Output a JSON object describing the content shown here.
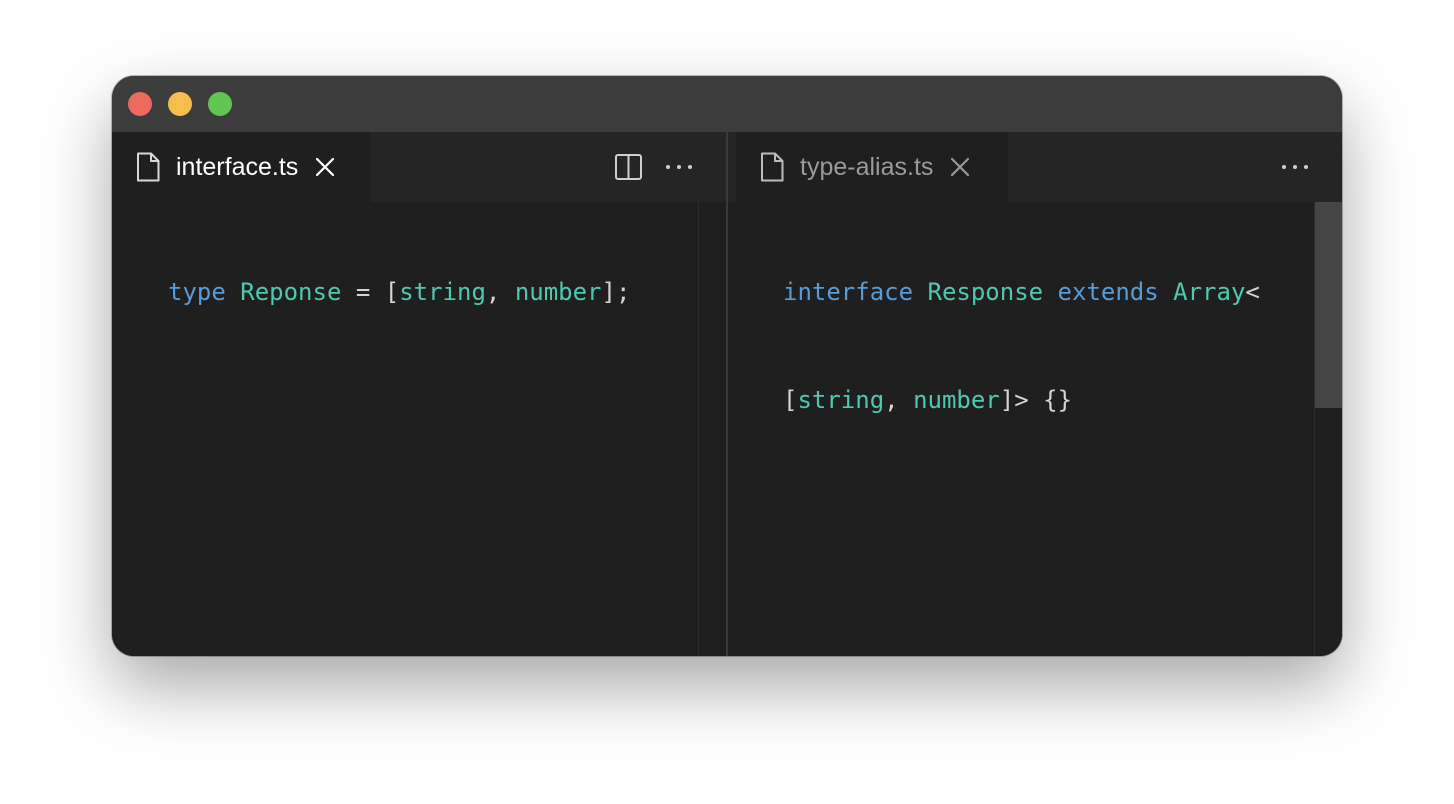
{
  "window": {
    "traffic_lights": [
      "close",
      "minimize",
      "maximize"
    ]
  },
  "left_pane": {
    "tab": {
      "label": "interface.ts",
      "icon": "file-icon",
      "close_icon": "close-icon"
    },
    "actions": [
      "split-editor-icon",
      "more-actions-icon"
    ],
    "code": {
      "line1": {
        "t1": "type",
        "t2": " ",
        "t3": "Reponse",
        "t4": " = [",
        "t5": "string",
        "t6": ", ",
        "t7": "number",
        "t8": "];"
      }
    }
  },
  "right_pane": {
    "tab": {
      "label": "type-alias.ts",
      "icon": "file-icon",
      "close_icon": "close-icon"
    },
    "actions": [
      "more-actions-icon"
    ],
    "code": {
      "line1": {
        "t1": "interface",
        "t2": " ",
        "t3": "Response",
        "t4": " ",
        "t5": "extends",
        "t6": " ",
        "t7": "Array",
        "t8": "<"
      },
      "line2": {
        "t1": "[",
        "t2": "string",
        "t3": ", ",
        "t4": "number",
        "t5": "]> {}"
      }
    }
  },
  "colors": {
    "keyword": "#569cd6",
    "type": "#4ec9b0",
    "punctuation": "#d4d4d4",
    "editor_bg": "#1f1f1f",
    "titlebar_bg": "#3c3c3c"
  }
}
